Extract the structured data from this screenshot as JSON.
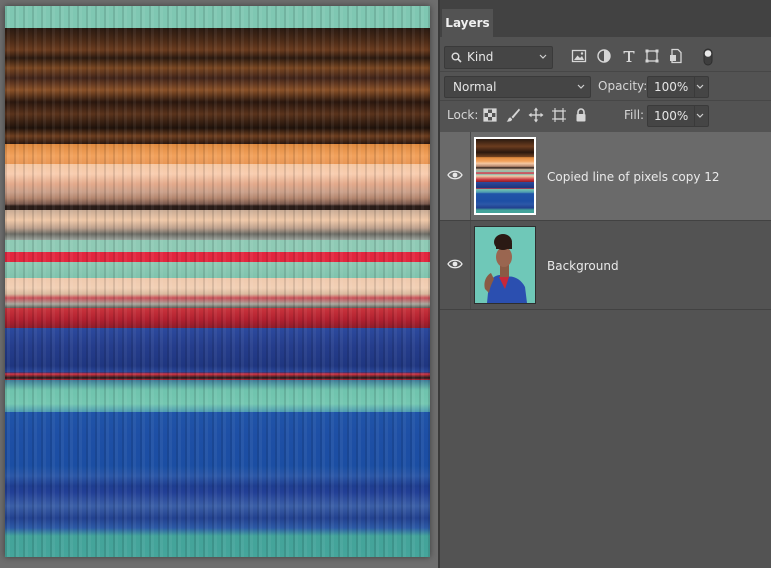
{
  "panel": {
    "tab_label": "Layers",
    "kind_filter": "Kind",
    "filter_icons": [
      "image-filter-icon",
      "adjustment-filter-icon",
      "type-filter-icon",
      "shape-filter-icon",
      "smart-object-filter-icon"
    ],
    "blend_mode": "Normal",
    "opacity_label": "Opacity:",
    "opacity_value": "100%",
    "lock_label": "Lock:",
    "lock_icons": [
      "lock-transparent-pixels-icon",
      "lock-image-pixels-icon",
      "lock-position-icon",
      "lock-artboard-icon",
      "lock-all-icon"
    ],
    "fill_label": "Fill:",
    "fill_value": "100%"
  },
  "layers": [
    {
      "name": "Copied line of pixels copy 12",
      "visible": true,
      "selected": true
    },
    {
      "name": "Background",
      "visible": true,
      "selected": false
    }
  ],
  "colors": {
    "panel_bg": "#535353",
    "selected_layer_bg": "#6a6a6a",
    "canvas_bg": "#6e6e6e"
  }
}
